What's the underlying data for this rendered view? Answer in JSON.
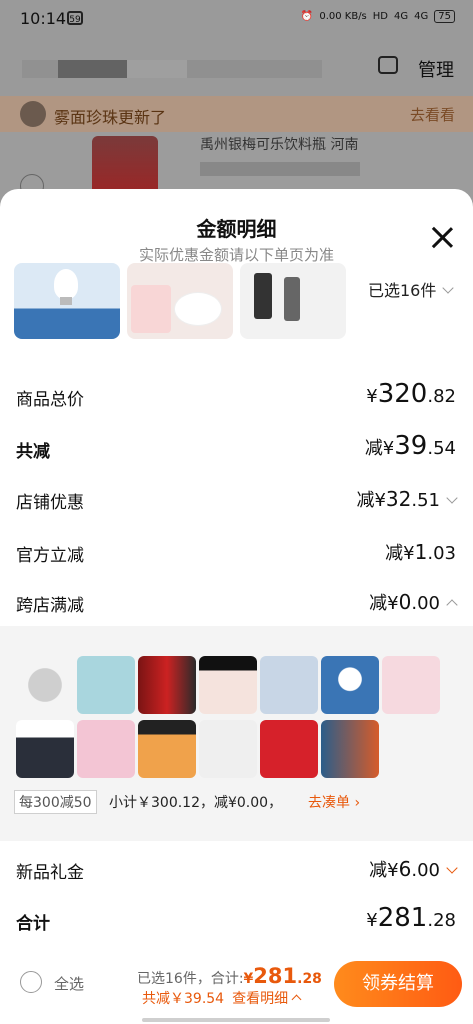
{
  "status_bar": {
    "time": "10:14",
    "notif_icon": "59",
    "net_speed": "0.00 KB/s",
    "hd": "HD",
    "signal1": "4G",
    "signal2": "4G",
    "battery": "75"
  },
  "header": {
    "manage": "管理"
  },
  "notice": {
    "text": "雾面珍珠更新了",
    "action": "去看看"
  },
  "bg_item": {
    "title_partial": "禹州银梅可乐饮料瓶 河南"
  },
  "sheet": {
    "title": "金额明细",
    "subtitle": "实际优惠金额请以下单页为准",
    "selected_count": "已选16件",
    "rows": {
      "total_label": "商品总价",
      "total_yen": "¥",
      "total_int": "320",
      "total_dec": ".82",
      "reduce_label": "共减",
      "reduce_prefix": "减¥",
      "reduce_int": "39",
      "reduce_dec": ".54",
      "store_label": "店铺优惠",
      "store_prefix": "减¥",
      "store_int": "32",
      "store_dec": ".51",
      "official_label": "官方立减",
      "official_prefix": "减¥",
      "official_int": "1",
      "official_dec": ".03",
      "cross_label": "跨店满减",
      "cross_prefix": "减¥",
      "cross_int": "0",
      "cross_dec": ".00",
      "gift_label": "新品礼金",
      "gift_prefix": "减¥",
      "gift_int": "6",
      "gift_dec": ".00",
      "sum_label": "合计",
      "sum_yen": "¥",
      "sum_int": "281",
      "sum_dec": ".28"
    },
    "cross_panel": {
      "tag": "每300减50",
      "subtotal": "小计￥300.12，减¥0.00，",
      "add_more": "去凑单"
    }
  },
  "bottom": {
    "select_all": "全选",
    "selected": "已选16件，合计:",
    "total_yen": "¥",
    "total_int": "281",
    "total_dec": ".28",
    "reduce_text": "共减￥39.54",
    "detail": "查看明细",
    "checkout": "领券结算"
  },
  "colors": {
    "accent": "#e8590c",
    "checkout_start": "#ff8b1c",
    "checkout_end": "#ff5b13"
  }
}
